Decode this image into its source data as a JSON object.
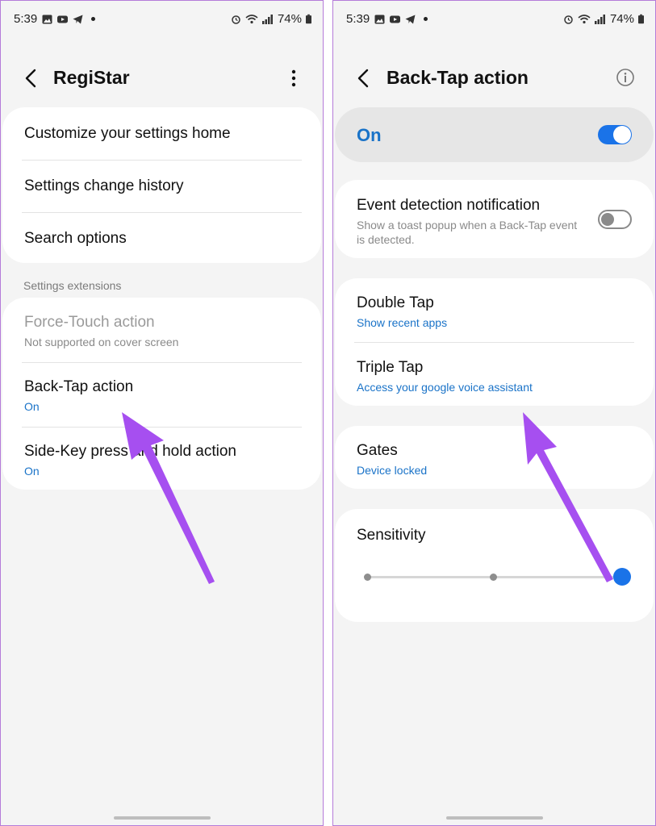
{
  "left": {
    "status": {
      "time": "5:39",
      "battery": "74%"
    },
    "title": "RegiStar",
    "settings_items": [
      "Customize your settings home",
      "Settings change history",
      "Search options"
    ],
    "section_label": "Settings extensions",
    "extensions": [
      {
        "title": "Force-Touch action",
        "subtitle": "Not supported on cover screen",
        "enabled": false
      },
      {
        "title": "Back-Tap action",
        "subtitle": "On",
        "enabled": true
      },
      {
        "title": "Side-Key press and hold action",
        "subtitle": "On",
        "enabled": true
      }
    ]
  },
  "right": {
    "status": {
      "time": "5:39",
      "battery": "74%"
    },
    "title": "Back-Tap action",
    "master_toggle": {
      "label": "On",
      "state": true
    },
    "event_detection": {
      "title": "Event detection notification",
      "description": "Show a toast popup when a Back-Tap event is detected.",
      "state": false
    },
    "taps": [
      {
        "title": "Double Tap",
        "action": "Show recent apps"
      },
      {
        "title": "Triple Tap",
        "action": "Access your google voice assistant"
      }
    ],
    "gates": {
      "title": "Gates",
      "value": "Device locked"
    },
    "sensitivity": {
      "title": "Sensitivity",
      "level_steps": 3,
      "selected_step": 3
    }
  },
  "colors": {
    "accent": "#1a73e8",
    "link_text": "#1a73c8",
    "background": "#f4f4f4",
    "card": "#ffffff",
    "annotation_arrow": "#a64ff0"
  },
  "icons": [
    "back-arrow-icon",
    "more-options-icon",
    "info-icon",
    "wifi-icon",
    "signal-icon",
    "battery-icon",
    "alarm-icon",
    "gallery-icon",
    "youtube-icon",
    "telegram-icon"
  ]
}
